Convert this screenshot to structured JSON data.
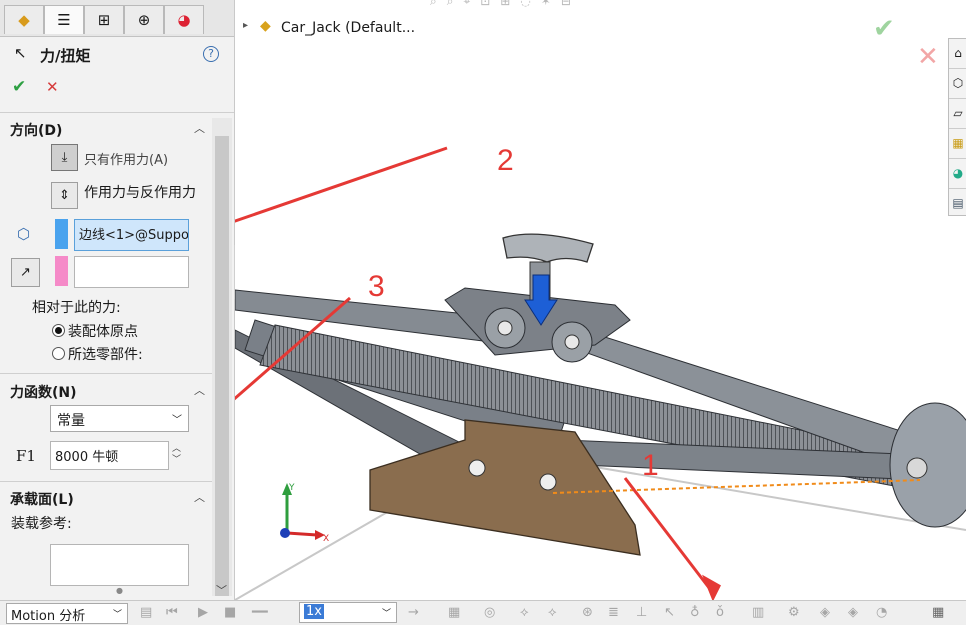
{
  "property_manager": {
    "title": "力/扭矩",
    "help": "?",
    "ok": "✔",
    "cancel": "✕",
    "direction": {
      "header": "方向(D)",
      "force_only": "只有作用力(A)",
      "action_reaction": "作用力与反作用力",
      "selected_edge": "边线<1>@Suppo",
      "relative_label": "相对于此的力:",
      "radio_assembly_origin": "装配体原点",
      "radio_selected_part": "所选零部件:"
    },
    "force_function": {
      "header": "力函数(N)",
      "function_type": "常量",
      "f1_label": "F1",
      "f1_value": "8000 牛顿"
    },
    "load_face": {
      "header": "承载面(L)",
      "ref_label": "装载参考:"
    }
  },
  "viewport": {
    "tree_item": "Car_Jack  (Default..."
  },
  "annotations": {
    "label_1": "1",
    "label_2": "2",
    "label_3": "3",
    "arrow_color": "#e53935"
  },
  "triad": {
    "x": "X",
    "y": "Y"
  },
  "bottom_toolbar": {
    "study_type": "Motion 分析",
    "playback_speed": "1x"
  },
  "colors": {
    "accent": "#4aa3ee",
    "ok_green": "#2ea043",
    "cancel_red": "#d63b3b",
    "force_arrow": "#1d5fd6"
  }
}
